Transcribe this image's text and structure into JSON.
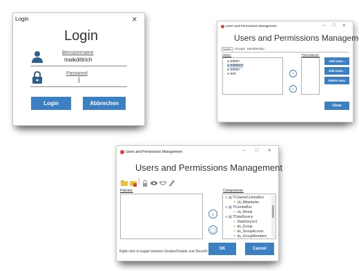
{
  "login": {
    "window_title": "Login",
    "close_glyph": "×",
    "heading": "Login",
    "username_label": "Benutzername",
    "username_value": "maikdittrich",
    "password_label": "Password",
    "password_value": "|",
    "login_button": "Login",
    "cancel_button": "Abbrechen"
  },
  "users_dialog": {
    "window_title": "Users and Permissions Management",
    "heading": "Users and Permissions Management",
    "minimize_glyph": "–",
    "maximize_glyph": "□",
    "close_glyph": "×",
    "tabs": [
      "Users",
      "Groups",
      "Membership"
    ],
    "users_label": "Users:",
    "permissions_label": "Permissions:",
    "users": [
      "admin",
      "mdittrich",
      "admin",
      "test"
    ],
    "add_user": "Add User...",
    "edit_user": "Edit User...",
    "delete_user": "Delete User",
    "close_button": "Close"
  },
  "permissions_dialog": {
    "window_title": "Users and Permissions Management",
    "heading": "Users and Permissions Management",
    "minimize_glyph": "–",
    "maximize_glyph": "□",
    "close_glyph": "×",
    "policies_label": "Policies:",
    "components_label": "Components:",
    "components": [
      {
        "label": "TColumnComboBox",
        "level": 0
      },
      {
        "label": "cb_Mitarbeiter",
        "level": 1
      },
      {
        "label": "TComboBox",
        "level": 0
      },
      {
        "label": "cb_Monat",
        "level": 1
      },
      {
        "label": "TDataSource",
        "level": 0
      },
      {
        "label": "DataSource1",
        "level": 1
      },
      {
        "label": "ds_Group",
        "level": 1
      },
      {
        "label": "ds_GroupAccess",
        "level": 1
      },
      {
        "label": "ds_GroupMembers",
        "level": 1
      }
    ],
    "hint": "Right-click to toggle between Enable/Disable and Show/Hi",
    "ok_button": "OK",
    "cancel_button": "Cancel"
  },
  "colors": {
    "accent": "#3c7fc2",
    "icon_blue": "#2f5f8f",
    "folder_yellow": "#f0c040"
  }
}
